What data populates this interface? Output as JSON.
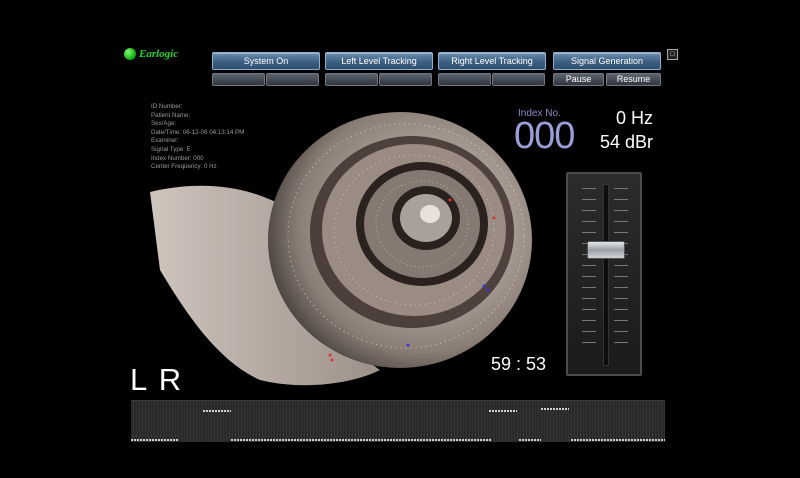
{
  "brand": {
    "name": "Earlogic"
  },
  "toolbar": {
    "buttons": [
      {
        "label": "System On"
      },
      {
        "label": "Left Level Tracking"
      },
      {
        "label": "Right Level Tracking"
      },
      {
        "label": "Signal Generation"
      }
    ],
    "pause_label": "Pause",
    "resume_label": "Resume"
  },
  "patient_info": {
    "lines": [
      "ID Number:",
      "Patient Name:",
      "Sex/Age:",
      "Date/Time: 06-12-06 04:13:14 PM",
      "Examiner:",
      "Signal Type: E",
      "Index Number: 000",
      "Center Frequency: 0 Hz"
    ]
  },
  "index": {
    "label": "Index No.",
    "value": "000"
  },
  "frequency": "0 Hz",
  "level": "54 dBr",
  "slider": {
    "level_fraction": 0.38
  },
  "timer": "59 : 53",
  "ears": "L R",
  "colors": {
    "button_blue": "#3c5f82",
    "index_purple": "#9a9ed8",
    "logo_green": "#28d428"
  }
}
